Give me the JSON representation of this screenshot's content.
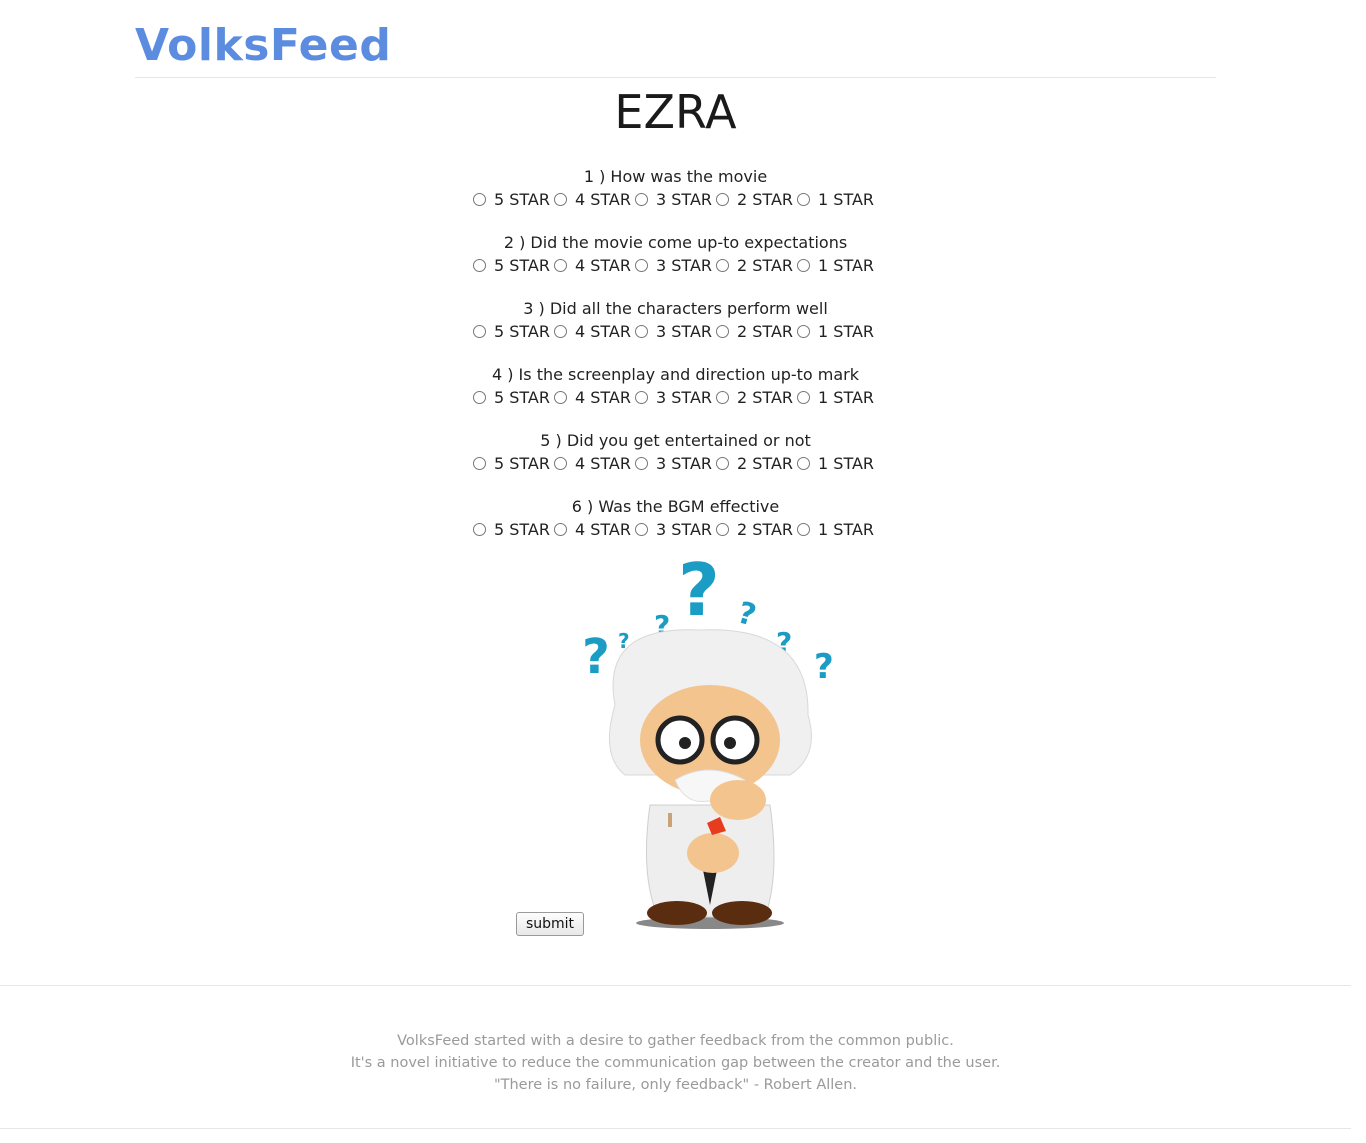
{
  "brand": "VolksFeed",
  "page_title": "EZRA",
  "options": [
    "5 STAR",
    "4 STAR",
    "3 STAR",
    "2 STAR",
    "1 STAR"
  ],
  "questions": [
    {
      "text": "1 ) How was the movie"
    },
    {
      "text": "2 ) Did the movie come up-to expectations"
    },
    {
      "text": "3 ) Did all the characters perform well"
    },
    {
      "text": "4 ) Is the screenplay and direction up-to mark"
    },
    {
      "text": "5 ) Did you get entertained or not"
    },
    {
      "text": "6 ) Was the BGM effective"
    }
  ],
  "submit_label": "submit",
  "footer": {
    "line1": "VolksFeed started with a desire to gather feedback from the common public.",
    "line2": "It's a novel initiative to reduce the communication gap between the creator and the user.",
    "line3": "\"There is no failure, only feedback\" - Robert Allen."
  },
  "colors": {
    "brand": "#5b8ce0",
    "question_mark": "#1a9cc4",
    "footer_text": "#9a9a9a"
  }
}
